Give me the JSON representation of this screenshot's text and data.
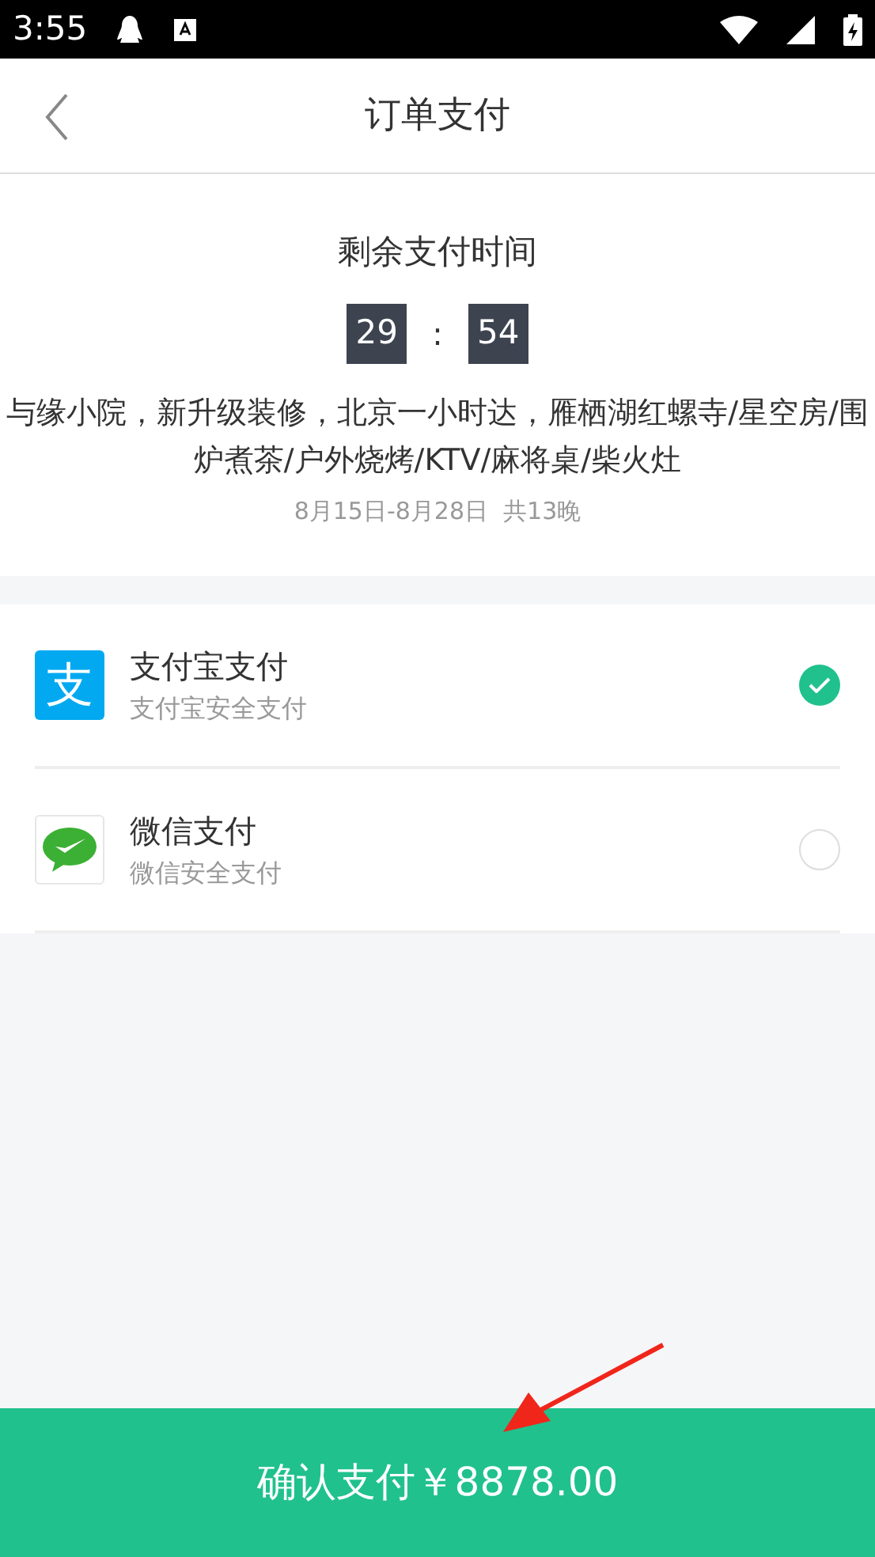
{
  "status_bar": {
    "time": "3:55"
  },
  "header": {
    "title": "订单支付"
  },
  "countdown": {
    "title": "剩余支付时间",
    "minutes": "29",
    "separator": ":",
    "seconds": "54"
  },
  "order": {
    "name": "与缘小院，新升级装修，北京一小时达，雁栖湖红螺寺/星空房/围炉煮茶/户外烧烤/KTV/麻将桌/柴火灶",
    "dates": "8月15日-8月28日  共13晚"
  },
  "payment_methods": [
    {
      "kind": "alipay",
      "icon_text": "支",
      "title": "支付宝支付",
      "subtitle": "支付宝安全支付",
      "selected": true
    },
    {
      "kind": "wechat",
      "title": "微信支付",
      "subtitle": "微信安全支付",
      "selected": false
    }
  ],
  "pay_button": {
    "label": "确认支付￥8878.00"
  }
}
